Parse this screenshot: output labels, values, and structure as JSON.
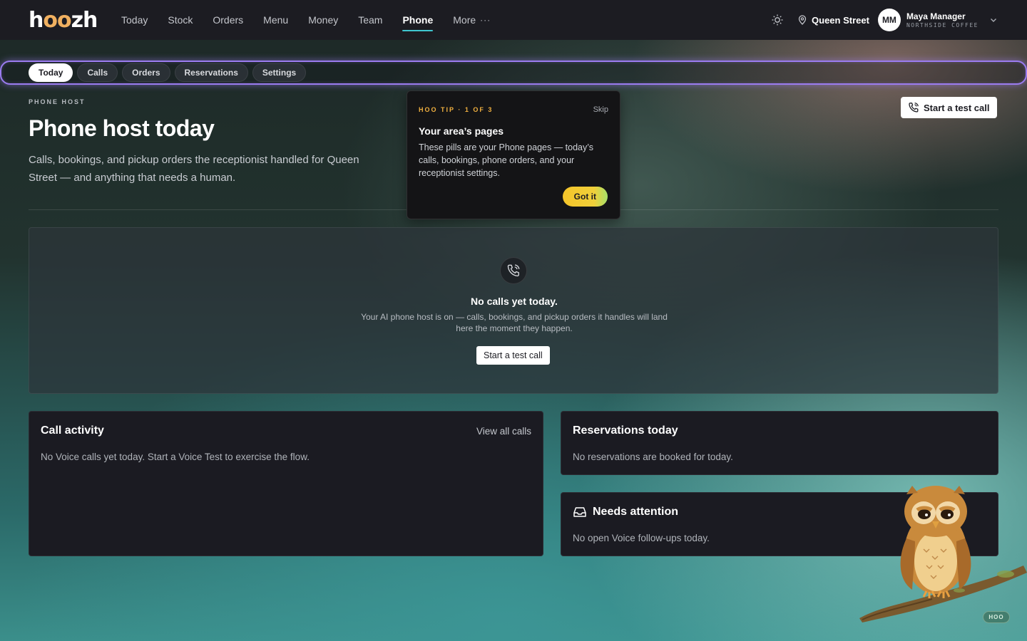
{
  "brand": {
    "logo_pre": "h",
    "logo_oo": "oo",
    "logo_post": "zh"
  },
  "nav": {
    "items": [
      {
        "label": "Today"
      },
      {
        "label": "Stock"
      },
      {
        "label": "Orders"
      },
      {
        "label": "Menu"
      },
      {
        "label": "Money"
      },
      {
        "label": "Team"
      },
      {
        "label": "Phone",
        "active": true
      },
      {
        "label": "More"
      }
    ],
    "more_dots": "···"
  },
  "top_right": {
    "location": "Queen Street",
    "avatar_initials": "MM",
    "user_name": "Maya Manager",
    "user_org": "NORTHSIDE COFFEE"
  },
  "subnav": {
    "pills": [
      {
        "label": "Today",
        "active": true
      },
      {
        "label": "Calls"
      },
      {
        "label": "Orders"
      },
      {
        "label": "Reservations"
      },
      {
        "label": "Settings"
      }
    ]
  },
  "header": {
    "eyebrow": "PHONE HOST",
    "title": "Phone host today",
    "description": "Calls, bookings, and pickup orders the receptionist handled for Queen Street — and anything that needs a human.",
    "action_label": "Start a test call"
  },
  "tip": {
    "eyebrow": "HOO TIP · 1 OF 3",
    "skip_label": "Skip",
    "title": "Your area’s pages",
    "body": "These pills are your Phone pages — today’s calls, bookings, phone orders, and your receptionist settings.",
    "button_label": "Got it"
  },
  "empty_calls": {
    "title": "No calls yet today.",
    "description": "Your AI phone host is on — calls, bookings, and pickup orders it handles will land here the moment they happen.",
    "button_label": "Start a test call"
  },
  "cards": {
    "activity": {
      "title": "Call activity",
      "link": "View all calls",
      "text": "No Voice calls yet today. Start a Voice Test to exercise the flow."
    },
    "reservations": {
      "title": "Reservations today",
      "text": "No reservations are booked for today."
    },
    "attention": {
      "title": "Needs attention",
      "text": "No open Voice follow-ups today."
    }
  },
  "mascot": {
    "badge": "HOO"
  },
  "icons": {
    "theme": "sun-icon",
    "location": "map-pin-icon",
    "chevron": "chevron-down-icon",
    "phone": "phone-call-icon",
    "inbox": "inbox-icon"
  },
  "colors": {
    "accent_underline": "#3fc6d0",
    "tip_eyebrow": "#f0b040",
    "highlight_ring": "#9b7cf0",
    "card_bg": "#1b1b22"
  }
}
